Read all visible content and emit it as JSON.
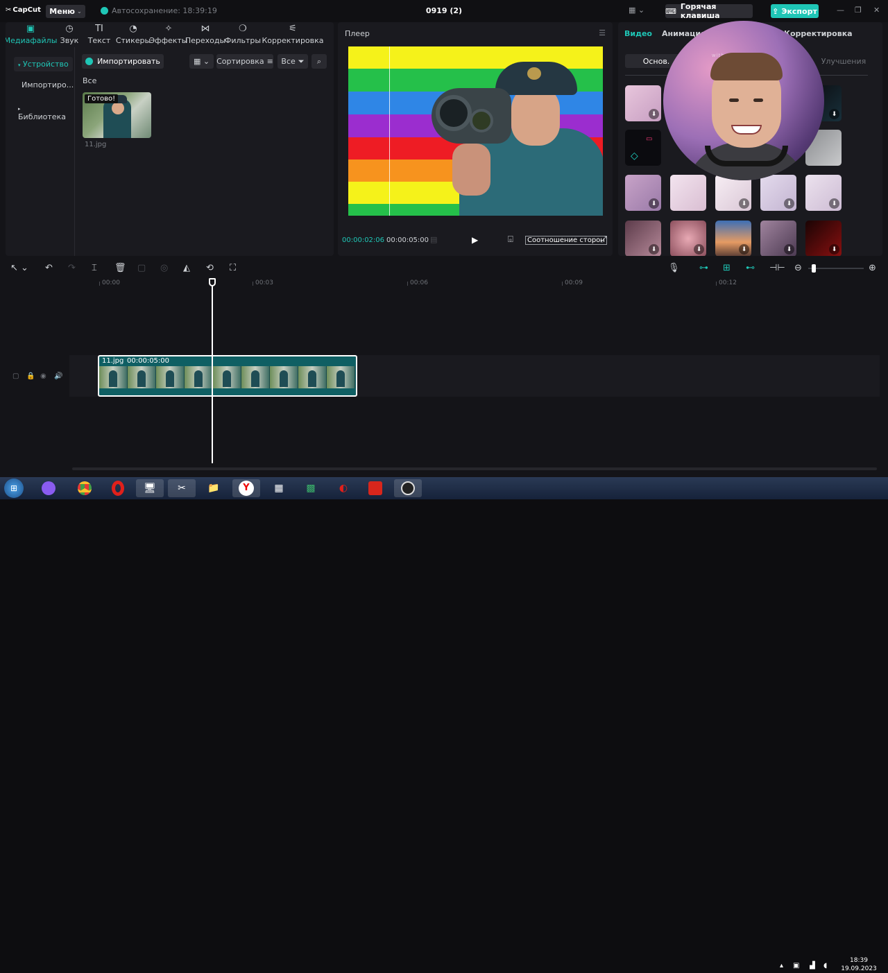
{
  "titlebar": {
    "app_name": "CapCut",
    "menu_label": "Меню",
    "autosave": "Автосохранение: 18:39:19",
    "project_title": "0919 (2)",
    "hotkey_label": "Горячая клавиша",
    "export_label": "Экспорт"
  },
  "media_tabs": [
    {
      "label": "Медиафайлы",
      "icon": "media-icon",
      "active": true
    },
    {
      "label": "Звук",
      "icon": "audio-icon"
    },
    {
      "label": "Текст",
      "icon": "text-icon"
    },
    {
      "label": "Стикеры",
      "icon": "sticker-icon"
    },
    {
      "label": "Эффекты",
      "icon": "effects-icon"
    },
    {
      "label": "Переходы",
      "icon": "transition-icon"
    },
    {
      "label": "Фильтры",
      "icon": "filter-icon"
    },
    {
      "label": "Корректировка",
      "icon": "adjust-icon"
    }
  ],
  "sidebar": {
    "device": "Устройство",
    "imported": "Импортиро...",
    "library": "Библиотека"
  },
  "media_panel": {
    "import_label": "Импортировать",
    "sort_label": "Сортировка",
    "filter_label": "Все",
    "all_label": "Все",
    "item_badge": "Готово!",
    "item_name": "11.jpg"
  },
  "player": {
    "title": "Плеер",
    "current_time": "00:00:02:06",
    "total_time": "00:00:05:00",
    "ratio_label": "Соотношение сторон"
  },
  "right_panel": {
    "tabs": [
      "Видео",
      "Анимация",
      "Корректировка"
    ],
    "subtabs": [
      "Основ.",
      "Улучшения"
    ]
  },
  "webcam": {
    "watermark": "with droidcam.app"
  },
  "timeline": {
    "ruler": [
      "00:00",
      "00:03",
      "00:06",
      "00:09",
      "00:12"
    ],
    "clip_name": "11.jpg",
    "clip_duration": "00:00:05:00"
  },
  "taskbar": {
    "time": "18:39",
    "date": "19.09.2023"
  },
  "colors": {
    "accent": "#1fc6b6",
    "panel": "#1a1a1f",
    "background": "#141418"
  }
}
